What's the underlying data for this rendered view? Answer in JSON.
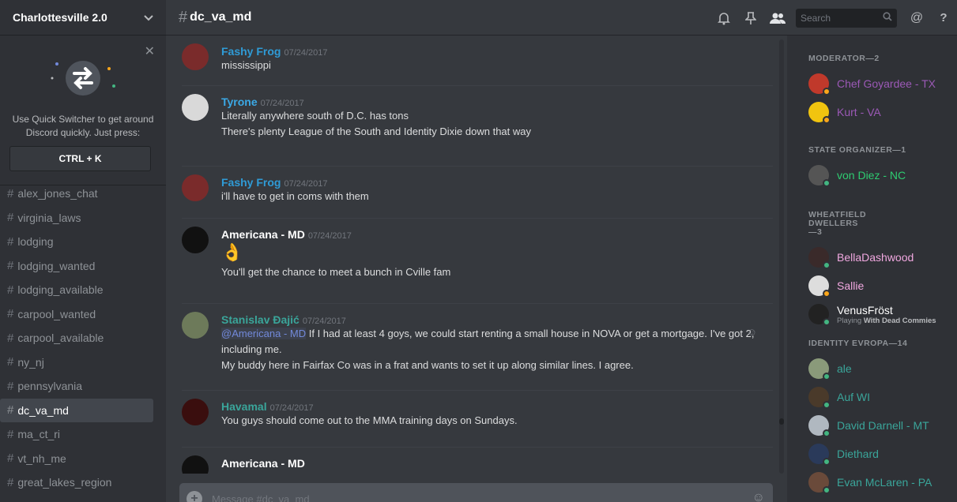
{
  "server": {
    "name": "Charlottesville 2.0"
  },
  "quick_switcher": {
    "text": "Use Quick Switcher to get around Discord quickly. Just press:",
    "shortcut": "CTRL + K"
  },
  "channels": [
    {
      "name": "alex_jones_chat"
    },
    {
      "name": "virginia_laws"
    },
    {
      "name": "lodging"
    },
    {
      "name": "lodging_wanted"
    },
    {
      "name": "lodging_available"
    },
    {
      "name": "carpool_wanted"
    },
    {
      "name": "carpool_available"
    },
    {
      "name": "ny_nj"
    },
    {
      "name": "pennsylvania"
    },
    {
      "name": "dc_va_md",
      "active": true
    },
    {
      "name": "ma_ct_ri"
    },
    {
      "name": "vt_nh_me"
    },
    {
      "name": "great_lakes_region"
    }
  ],
  "topbar": {
    "channel": "dc_va_md",
    "search_placeholder": "Search"
  },
  "messages": [
    {
      "author": "Fashy Frog",
      "color": "#2f9bd6",
      "time": "07/24/2017",
      "lines": [
        "mississippi"
      ]
    },
    {
      "author": "Tyrone",
      "color": "#3ba9e6",
      "time": "07/24/2017",
      "lines": [
        "Literally anywhere south of D.C. has tons",
        "There's plenty League of the South and Identity Dixie down that way"
      ]
    },
    {
      "author": "Fashy Frog",
      "color": "#2f9bd6",
      "time": "07/24/2017",
      "lines": [
        "i'll have to get in coms with them"
      ]
    },
    {
      "author": "Americana - MD",
      "color": "#ffffff",
      "time": "07/24/2017",
      "lines": [
        "You'll get the chance to meet a bunch in Cville fam"
      ],
      "emoji": "👌"
    },
    {
      "author": "Stanislav Đajić",
      "color": "#3aa59a",
      "time": "07/24/2017",
      "mention": "@Americana - MD",
      "lines": [
        "If I had at least 4 goys, we could start renting a small house in NOVA or get a mortgage. I've got 2, including me.",
        "My buddy here in Fairfax Co was in a frat and wants to set it up along similar lines. I agree."
      ]
    },
    {
      "author": "Havamal",
      "color": "#3aa59a",
      "time": "07/24/2017",
      "lines": [
        "You guys should come out to the MMA training days on Sundays."
      ]
    },
    {
      "author": "Americana - MD",
      "color": "#ffffff",
      "time": "",
      "lines": []
    }
  ],
  "composer": {
    "placeholder": "Message #dc_va_md"
  },
  "member_groups": [
    {
      "title": "MODERATOR—2",
      "members": [
        {
          "name": "Chef Goyardee - TX",
          "color": "#9b59b6",
          "status": "#faa61a"
        },
        {
          "name": "Kurt - VA",
          "color": "#9b59b6",
          "status": "#faa61a"
        }
      ]
    },
    {
      "title": "STATE ORGANIZER—1",
      "members": [
        {
          "name": "von Diez - NC",
          "color": "#2ecc71",
          "status": "#43b581"
        }
      ]
    },
    {
      "title": "WHEATFIELD DWELLERS—3",
      "members": [
        {
          "name": "BellaDashwood",
          "color": "#f1a8e0",
          "status": "#43b581"
        },
        {
          "name": "Sallie",
          "color": "#f1a8e0",
          "status": "#faa61a"
        },
        {
          "name": "VenusFröst",
          "color": "#ffffff",
          "status": "#43b581",
          "game_prefix": "Playing ",
          "game": "With Dead Commies"
        }
      ]
    },
    {
      "title": "IDENTITY EVROPA—14",
      "members": [
        {
          "name": "ale",
          "color": "#3aa59a",
          "status": "#43b581"
        },
        {
          "name": "Auf WI",
          "color": "#3aa59a",
          "status": "#43b581"
        },
        {
          "name": "David Darnell - MT",
          "color": "#3aa59a",
          "status": "#43b581"
        },
        {
          "name": "Diethard",
          "color": "#3aa59a",
          "status": "#43b581"
        },
        {
          "name": "Evan McLaren - PA",
          "color": "#3aa59a",
          "status": "#43b581"
        }
      ]
    }
  ]
}
